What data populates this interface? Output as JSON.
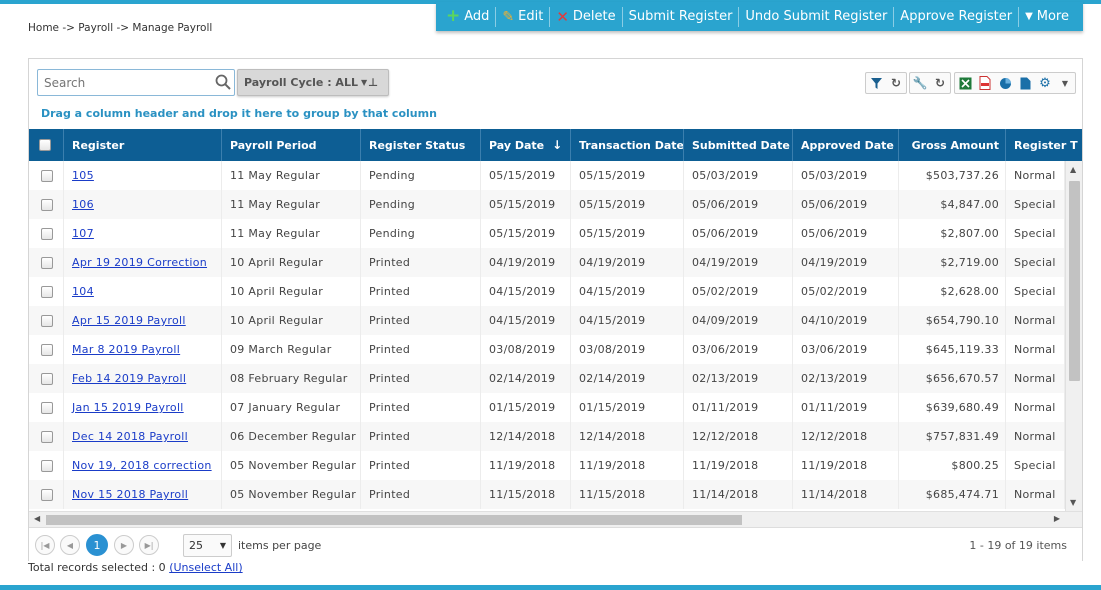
{
  "toolbar": {
    "add_label": "Add",
    "edit_label": "Edit",
    "delete_label": "Delete",
    "submit_label": "Submit Register",
    "undo_submit_label": "Undo Submit Register",
    "approve_label": "Approve Register",
    "more_label": "More"
  },
  "breadcrumb": "Home -> Payroll -> Manage Payroll",
  "search": {
    "placeholder": "Search",
    "value": ""
  },
  "cycle_filter": {
    "label": "Payroll Cycle : ALL"
  },
  "group_hint": "Drag a column header and drop it here to group by that column",
  "icons": [
    "filter-icon",
    "refresh-icon",
    "wrench-icon",
    "refresh-icon",
    "excel-icon",
    "pdf-icon",
    "pie-chart-icon",
    "document-icon",
    "gear-icon",
    "chevron-down-icon"
  ],
  "columns": [
    "Register",
    "Payroll Period",
    "Register Status",
    "Pay Date",
    "Transaction Date",
    "Submitted Date",
    "Approved Date",
    "Gross Amount",
    "Register T"
  ],
  "rows": [
    {
      "register": "105",
      "period": "11 May Regular",
      "status": "Pending",
      "pay_date": "05/15/2019",
      "txn_date": "05/15/2019",
      "submitted": "05/03/2019",
      "approved": "05/03/2019",
      "gross": "$503,737.26",
      "type": "Normal"
    },
    {
      "register": "106",
      "period": "11 May Regular",
      "status": "Pending",
      "pay_date": "05/15/2019",
      "txn_date": "05/15/2019",
      "submitted": "05/06/2019",
      "approved": "05/06/2019",
      "gross": "$4,847.00",
      "type": "Special"
    },
    {
      "register": "107",
      "period": "11 May Regular",
      "status": "Pending",
      "pay_date": "05/15/2019",
      "txn_date": "05/15/2019",
      "submitted": "05/06/2019",
      "approved": "05/06/2019",
      "gross": "$2,807.00",
      "type": "Special"
    },
    {
      "register": "Apr 19 2019 Correction",
      "period": "10 April Regular",
      "status": "Printed",
      "pay_date": "04/19/2019",
      "txn_date": "04/19/2019",
      "submitted": "04/19/2019",
      "approved": "04/19/2019",
      "gross": "$2,719.00",
      "type": "Special"
    },
    {
      "register": "104",
      "period": "10 April Regular",
      "status": "Printed",
      "pay_date": "04/15/2019",
      "txn_date": "04/15/2019",
      "submitted": "05/02/2019",
      "approved": "05/02/2019",
      "gross": "$2,628.00",
      "type": "Special"
    },
    {
      "register": "Apr 15 2019 Payroll",
      "period": "10 April Regular",
      "status": "Printed",
      "pay_date": "04/15/2019",
      "txn_date": "04/15/2019",
      "submitted": "04/09/2019",
      "approved": "04/10/2019",
      "gross": "$654,790.10",
      "type": "Normal"
    },
    {
      "register": "Mar 8 2019 Payroll",
      "period": "09 March Regular",
      "status": "Printed",
      "pay_date": "03/08/2019",
      "txn_date": "03/08/2019",
      "submitted": "03/06/2019",
      "approved": "03/06/2019",
      "gross": "$645,119.33",
      "type": "Normal"
    },
    {
      "register": "Feb 14 2019 Payroll",
      "period": "08 February Regular",
      "status": "Printed",
      "pay_date": "02/14/2019",
      "txn_date": "02/14/2019",
      "submitted": "02/13/2019",
      "approved": "02/13/2019",
      "gross": "$656,670.57",
      "type": "Normal"
    },
    {
      "register": "Jan 15 2019 Payroll",
      "period": "07 January Regular",
      "status": "Printed",
      "pay_date": "01/15/2019",
      "txn_date": "01/15/2019",
      "submitted": "01/11/2019",
      "approved": "01/11/2019",
      "gross": "$639,680.49",
      "type": "Normal"
    },
    {
      "register": "Dec 14 2018 Payroll",
      "period": "06 December Regular",
      "status": "Printed",
      "pay_date": "12/14/2018",
      "txn_date": "12/14/2018",
      "submitted": "12/12/2018",
      "approved": "12/12/2018",
      "gross": "$757,831.49",
      "type": "Normal"
    },
    {
      "register": "Nov 19, 2018 correction",
      "period": "05 November Regular",
      "status": "Printed",
      "pay_date": "11/19/2018",
      "txn_date": "11/19/2018",
      "submitted": "11/19/2018",
      "approved": "11/19/2018",
      "gross": "$800.25",
      "type": "Special"
    },
    {
      "register": "Nov 15 2018 Payroll",
      "period": "05 November Regular",
      "status": "Printed",
      "pay_date": "11/15/2018",
      "txn_date": "11/15/2018",
      "submitted": "11/14/2018",
      "approved": "11/14/2018",
      "gross": "$685,474.71",
      "type": "Normal"
    }
  ],
  "pager": {
    "current_page": "1",
    "page_size": "25",
    "items_per_page_label": "items per page",
    "info": "1 - 19 of 19 items"
  },
  "footer": {
    "selected_text": "Total records selected : 0",
    "unselect_label": "(Unselect All)"
  },
  "colors": {
    "accent": "#2aa4cf",
    "header_bg": "#0d5e94",
    "link": "#1a3cc8",
    "hint": "#2a91c2"
  }
}
